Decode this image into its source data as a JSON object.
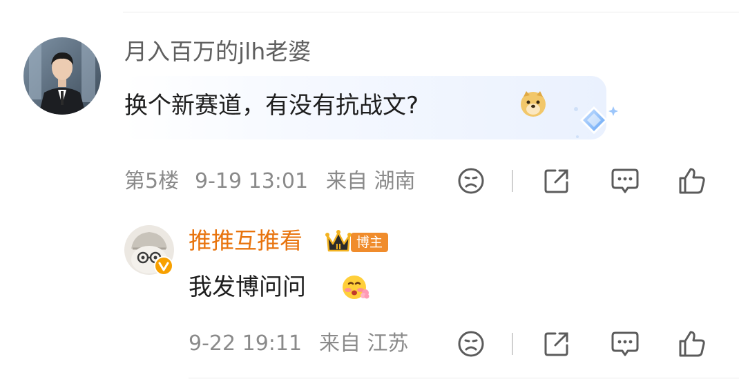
{
  "comments": [
    {
      "username": "月入百万的jlh老婆",
      "text": "换个新赛道，有没有抗战文?",
      "floor": "第5楼",
      "time": "9-19 13:01",
      "location": "来自 湖南"
    }
  ],
  "reply": {
    "username": "推推互推看",
    "badge": "博主",
    "text": "我发博问问",
    "time": "9-22 19:11",
    "location": "来自 江苏"
  },
  "colors": {
    "username_primary": "#5f5f5f",
    "username_blogger": "#e8740e",
    "badge_bg": "#f08c2c",
    "meta": "#8a8a8a"
  },
  "icons": [
    "dislike-icon",
    "share-icon",
    "comment-icon",
    "like-icon",
    "doge-emoji",
    "shy-emoji",
    "crown-icon",
    "verified-icon"
  ]
}
